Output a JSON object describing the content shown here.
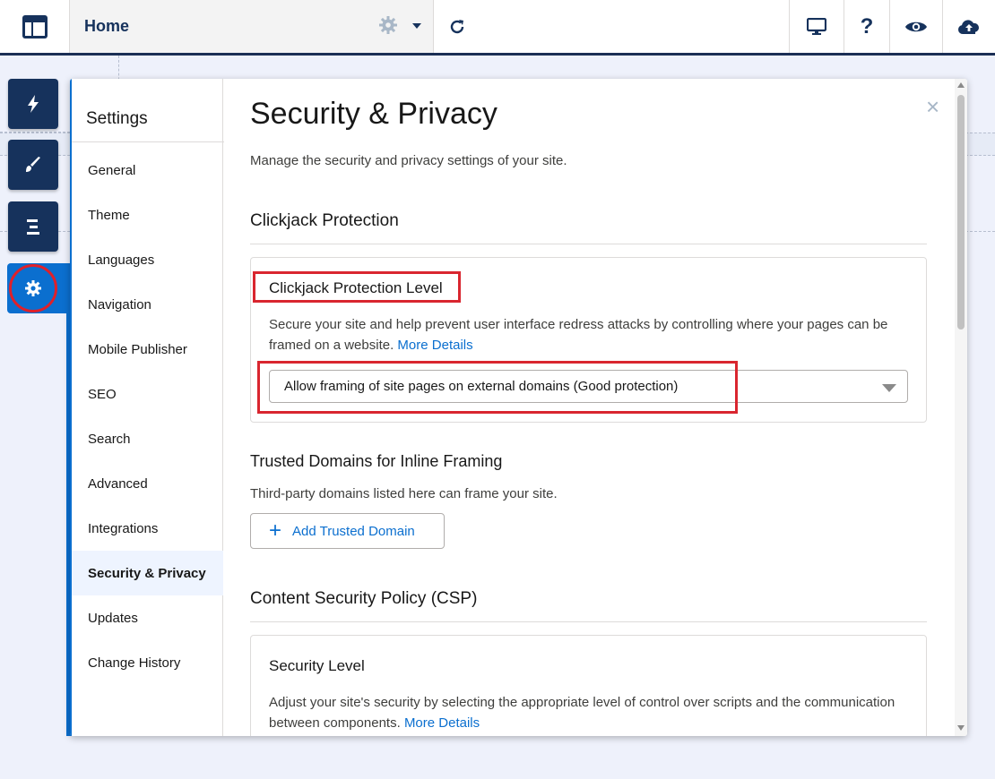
{
  "topbar": {
    "page_name": "Home",
    "icons": [
      "layout-icon",
      "gear-icon",
      "chevron-down-icon",
      "refresh-icon",
      "desktop-icon",
      "help-icon",
      "preview-eye-icon",
      "publish-cloud-icon"
    ],
    "help_glyph": "?"
  },
  "rail": {
    "items": [
      "components-lightning-icon",
      "theme-brush-icon",
      "navigation-menu-icon",
      "settings-gear-icon"
    ],
    "active": "settings-gear-icon"
  },
  "settings": {
    "title": "Settings",
    "nav": [
      {
        "label": "General"
      },
      {
        "label": "Theme"
      },
      {
        "label": "Languages"
      },
      {
        "label": "Navigation"
      },
      {
        "label": "Mobile Publisher"
      },
      {
        "label": "SEO"
      },
      {
        "label": "Search"
      },
      {
        "label": "Advanced"
      },
      {
        "label": "Integrations"
      },
      {
        "label": "Security & Privacy"
      },
      {
        "label": "Updates"
      },
      {
        "label": "Change History"
      }
    ],
    "active_nav": "Security & Privacy"
  },
  "page": {
    "close_glyph": "×",
    "title": "Security & Privacy",
    "description": "Manage the security and privacy settings of your site.",
    "clickjack": {
      "section_title": "Clickjack Protection",
      "level_title": "Clickjack Protection Level",
      "text": "Secure your site and help prevent user interface redress attacks by controlling where your pages can be framed on a website.",
      "link": "More Details",
      "selected_option": "Allow framing of site pages on external domains (Good protection)"
    },
    "trusted": {
      "title": "Trusted Domains for Inline Framing",
      "text": "Third-party domains listed here can frame your site.",
      "plus_glyph": "+",
      "button": "Add Trusted Domain"
    },
    "csp": {
      "section_title": "Content Security Policy (CSP)",
      "level_title": "Security Level",
      "text": "Adjust your site's security by selecting the appropriate level of control over scripts and the communication between components.",
      "link": "More Details"
    }
  },
  "colors": {
    "navy": "#16325c",
    "accent": "#0b6fcf",
    "highlight": "#d9262f"
  }
}
